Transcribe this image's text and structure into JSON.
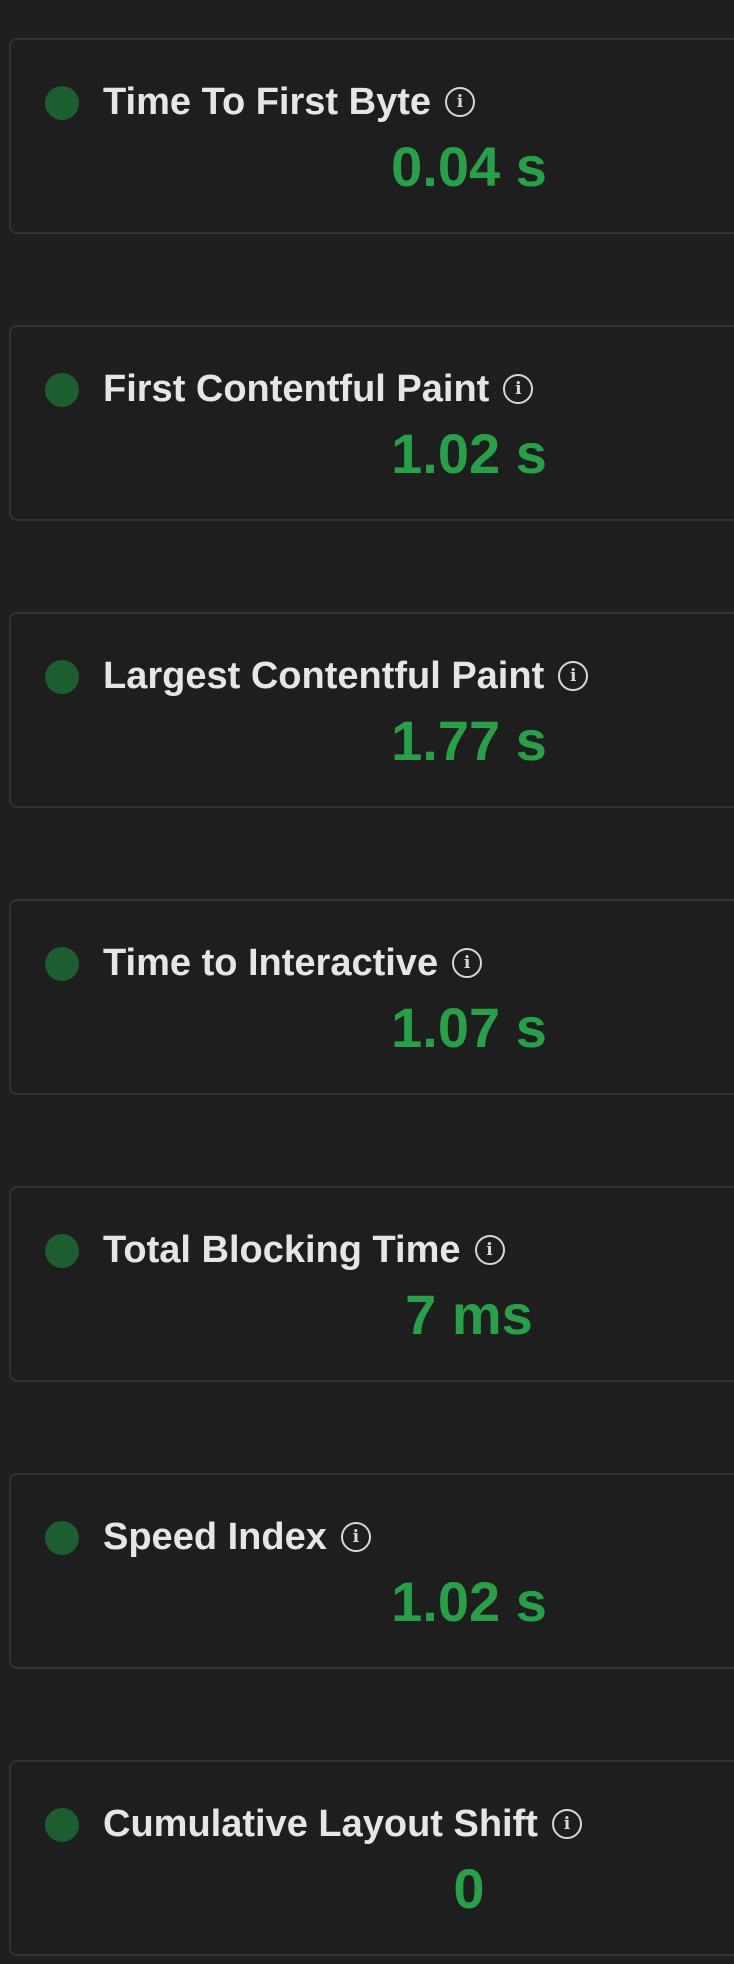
{
  "colors": {
    "background": "#1f1f1f",
    "card_border": "#333333",
    "status_good_dot": "#1d5e30",
    "value_good": "#27a049",
    "title_text": "#e6e6e6"
  },
  "info_icon": {
    "glyph": "i",
    "name": "info-icon"
  },
  "metrics": [
    {
      "label": "Time To First Byte",
      "value": "0.04 s",
      "status": "good"
    },
    {
      "label": "First Contentful Paint",
      "value": "1.02 s",
      "status": "good"
    },
    {
      "label": "Largest Contentful Paint",
      "value": "1.77 s",
      "status": "good"
    },
    {
      "label": "Time to Interactive",
      "value": "1.07 s",
      "status": "good"
    },
    {
      "label": "Total Blocking Time",
      "value": "7 ms",
      "status": "good"
    },
    {
      "label": "Speed Index",
      "value": "1.02 s",
      "status": "good"
    },
    {
      "label": "Cumulative Layout Shift",
      "value": "0",
      "status": "good"
    }
  ]
}
